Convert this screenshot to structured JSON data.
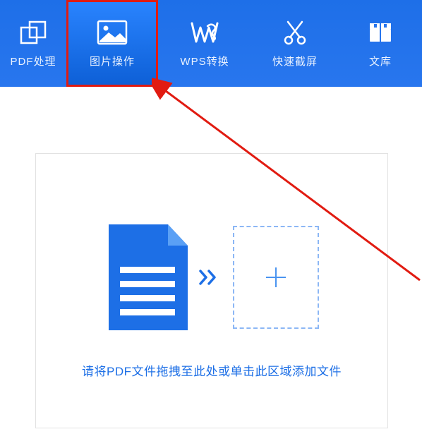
{
  "colors": {
    "primary": "#1d6fe6",
    "annotation": "#e11b11"
  },
  "toolbar": {
    "items": [
      {
        "label": "PDF处理",
        "icon": "overlap-icon"
      },
      {
        "label": "图片操作",
        "icon": "image-icon"
      },
      {
        "label": "WPS转换",
        "icon": "wps-icon"
      },
      {
        "label": "快速截屏",
        "icon": "scissors-icon"
      },
      {
        "label": "文库",
        "icon": "library-icon"
      }
    ],
    "active_index": 1,
    "highlighted_index": 1
  },
  "drop_area": {
    "instruction": "请将PDF文件拖拽至此处或单击此区域添加文件",
    "add_symbol": "+"
  }
}
